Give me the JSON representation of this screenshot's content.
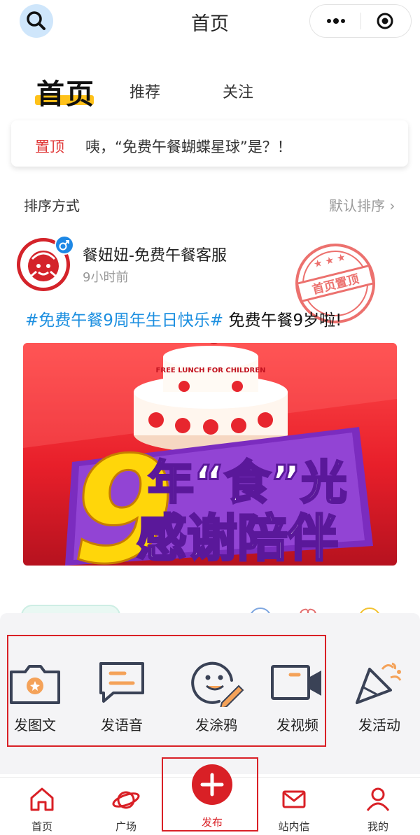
{
  "header": {
    "title": "首页"
  },
  "tabs": [
    {
      "label": "首页"
    },
    {
      "label": "推荐"
    },
    {
      "label": "关注"
    }
  ],
  "pinned": {
    "tag": "置顶",
    "text": "咦，“免费午餐蝴蝶星球”是？！"
  },
  "sort": {
    "label": "排序方式",
    "value": "默认排序 ›"
  },
  "post": {
    "author": "餐妞妞-免费午餐客服",
    "time": "9小时前",
    "stamp": "首页置顶",
    "hashtag": "#免费午餐9周年生日快乐#",
    "text": " 免费午餐9岁啦!",
    "banner": {
      "top_line": "FREE LUNCH FOR CHILDREN",
      "number": "9",
      "line1": "年“食”光",
      "line2": "感谢陪伴"
    }
  },
  "actions": [
    {
      "label": "发图文",
      "icon": "camera-icon"
    },
    {
      "label": "发语音",
      "icon": "voice-message-icon"
    },
    {
      "label": "发涂鸦",
      "icon": "doodle-face-icon"
    },
    {
      "label": "发视频",
      "icon": "video-camera-icon"
    },
    {
      "label": "发活动",
      "icon": "party-popper-icon"
    }
  ],
  "nav": {
    "home": "首页",
    "plaza": "广场",
    "publish": "发布",
    "inbox": "站内信",
    "mine": "我的"
  },
  "colors": {
    "accent": "#d92026",
    "hashtag": "#1c8fe0",
    "tab_highlight": "#ffc21a"
  }
}
